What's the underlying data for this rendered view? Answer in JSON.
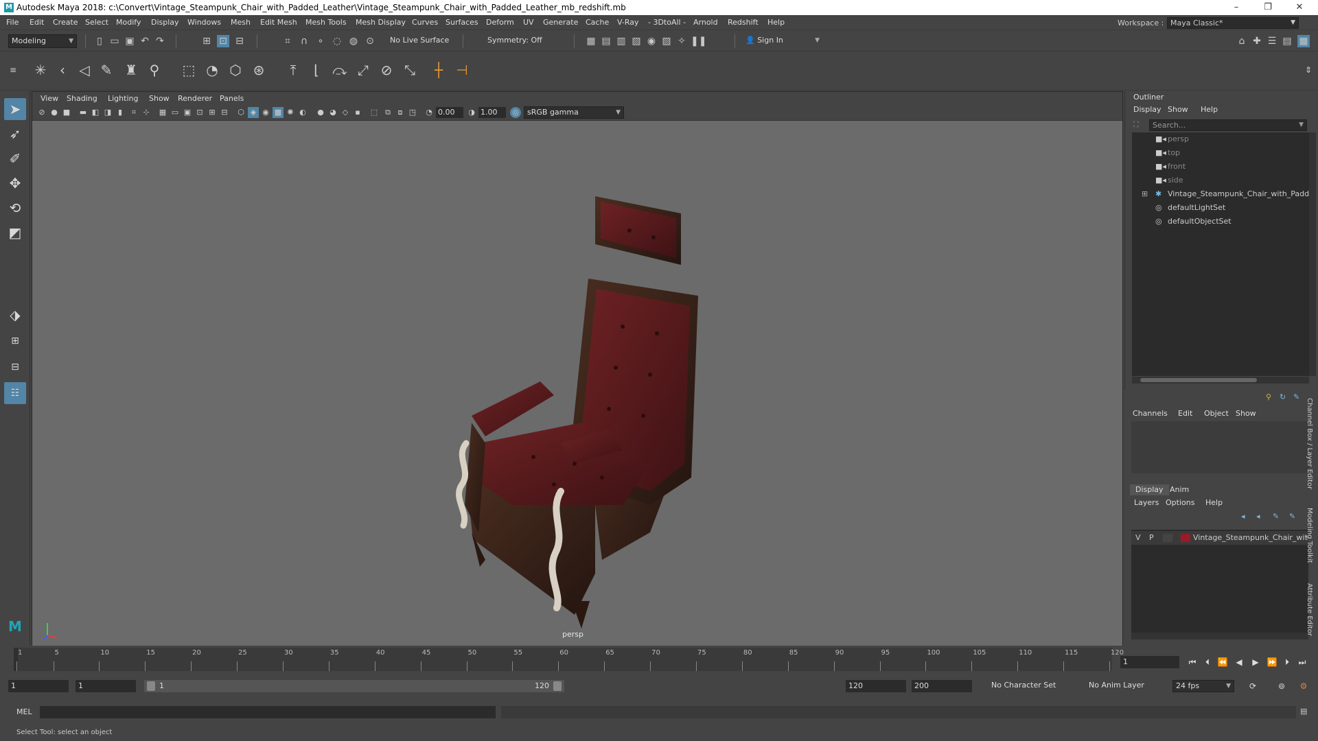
{
  "titlebar": {
    "logo": "M",
    "title": "Autodesk Maya 2018: c:\\Convert\\Vintage_Steampunk_Chair_with_Padded_Leather\\Vintage_Steampunk_Chair_with_Padded_Leather_mb_redshift.mb",
    "minimize": "–",
    "maximize": "❐",
    "close": "✕"
  },
  "menubar": {
    "items": [
      "File",
      "Edit",
      "Create",
      "Select",
      "Modify",
      "Display",
      "Windows",
      "Mesh",
      "Edit Mesh",
      "Mesh Tools",
      "Mesh Display",
      "Curves",
      "Surfaces",
      "Deform",
      "UV",
      "Generate",
      "Cache",
      "V-Ray",
      "- 3DtoAll -",
      "Arnold",
      "Redshift",
      "Help"
    ],
    "workspace_label": "Workspace :",
    "workspace_value": "Maya Classic*"
  },
  "statusline": {
    "mode": "Modeling",
    "live_surface": "No Live Surface",
    "symmetry": "Symmetry: Off",
    "sign_in": "Sign In"
  },
  "viewport": {
    "menus": [
      "View",
      "Shading",
      "Lighting",
      "Show",
      "Renderer",
      "Panels"
    ],
    "exposure": "0.00",
    "gamma": "1.00",
    "color_space": "sRGB gamma",
    "camera": "persp"
  },
  "outliner": {
    "title": "Outliner",
    "menus": [
      "Display",
      "Show",
      "Help"
    ],
    "search_placeholder": "Search...",
    "items": [
      {
        "label": "persp",
        "dim": true,
        "icon": "camera-icon"
      },
      {
        "label": "top",
        "dim": true,
        "icon": "camera-icon"
      },
      {
        "label": "front",
        "dim": true,
        "icon": "camera-icon"
      },
      {
        "label": "side",
        "dim": true,
        "icon": "camera-icon"
      },
      {
        "label": "Vintage_Steampunk_Chair_with_Padded",
        "dim": false,
        "icon": "group-icon"
      },
      {
        "label": "defaultLightSet",
        "dim": false,
        "icon": "set-icon"
      },
      {
        "label": "defaultObjectSet",
        "dim": false,
        "icon": "set-icon"
      }
    ]
  },
  "channelbox": {
    "menus": [
      "Channels",
      "Edit",
      "Object",
      "Show"
    ]
  },
  "layereditor": {
    "tabs": [
      "Display",
      "Anim"
    ],
    "menus": [
      "Layers",
      "Options",
      "Help"
    ],
    "layer": {
      "v": "V",
      "p": "P",
      "name": "Vintage_Steampunk_Chair_wit",
      "color": "#9a1a2a"
    }
  },
  "side_tabs": [
    "Channel Box / Layer Editor",
    "Modeling Toolkit",
    "Attribute Editor"
  ],
  "timeslider": {
    "ticks": [
      1,
      5,
      10,
      15,
      20,
      25,
      30,
      35,
      40,
      45,
      50,
      55,
      60,
      65,
      70,
      75,
      80,
      85,
      90,
      95,
      100,
      105,
      110,
      115,
      120
    ],
    "current_frame": "1"
  },
  "rangeslider": {
    "start": "1",
    "playback_start": "1",
    "range_start": "1",
    "range_end": "120",
    "playback_end": "120",
    "end": "200",
    "character_set": "No Character Set",
    "anim_layer": "No Anim Layer",
    "fps": "24 fps"
  },
  "cmdline": {
    "label": "MEL"
  },
  "helpline": {
    "text": "Select Tool: select an object"
  },
  "colors": {
    "accent": "#5285a6",
    "leather": "#5a1a1c",
    "wood": "#3a2418"
  }
}
